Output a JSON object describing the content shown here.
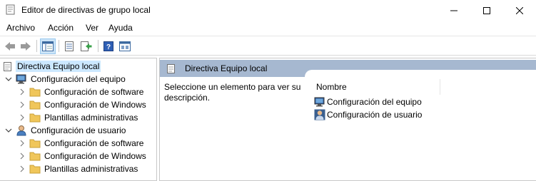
{
  "window": {
    "title": "Editor de directivas de grupo local"
  },
  "menu": [
    "Archivo",
    "Acción",
    "Ver",
    "Ayuda"
  ],
  "tree": {
    "root": "Directiva Equipo local",
    "computer": {
      "label": "Configuración del equipo",
      "children": [
        "Configuración de software",
        "Configuración de Windows",
        "Plantillas administrativas"
      ]
    },
    "user": {
      "label": "Configuración de usuario",
      "children": [
        "Configuración de software",
        "Configuración de Windows",
        "Plantillas administrativas"
      ]
    }
  },
  "details": {
    "header": "Directiva Equipo local",
    "description": "Seleccione un elemento para ver su descripción.",
    "column": "Nombre",
    "items": [
      "Configuración del equipo",
      "Configuración de usuario"
    ]
  },
  "colors": {
    "selection": "#cce8ff",
    "header_band": "#a6b8d0",
    "folder": "#f0c65a"
  }
}
